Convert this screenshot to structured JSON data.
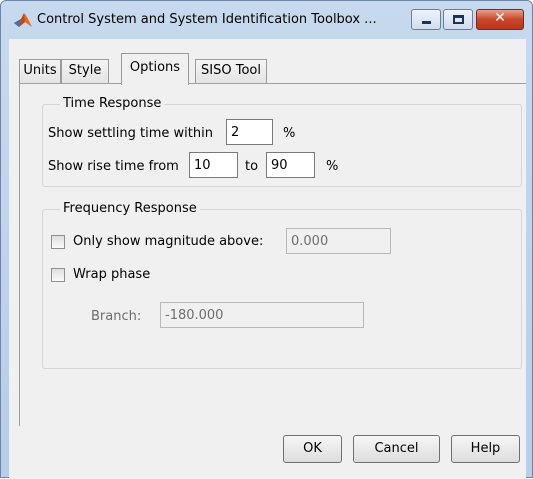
{
  "window": {
    "title": "Control System and System Identification Toolbox ...",
    "icon": "matlab-icon",
    "controls": {
      "minimize": "minimize-icon",
      "maximize": "maximize-icon",
      "close": "close-icon"
    }
  },
  "tabs": [
    {
      "label": "Units"
    },
    {
      "label": "Style"
    },
    {
      "label": "Options",
      "active": true
    },
    {
      "label": "SISO Tool"
    }
  ],
  "time_response": {
    "title": "Time Response",
    "settling_label": "Show settling time within",
    "settling_value": "2",
    "settling_unit": "%",
    "rise_label": "Show rise time from",
    "rise_from": "10",
    "rise_to_label": "to",
    "rise_to": "90",
    "rise_unit": "%"
  },
  "frequency_response": {
    "title": "Frequency Response",
    "magnitude_label": "Only show magnitude above:",
    "magnitude_checked": false,
    "magnitude_value": "0.000",
    "wrap_label": "Wrap phase",
    "wrap_checked": false,
    "branch_label": "Branch:",
    "branch_value": "-180.000"
  },
  "buttons": {
    "ok": "OK",
    "cancel": "Cancel",
    "help": "Help"
  }
}
